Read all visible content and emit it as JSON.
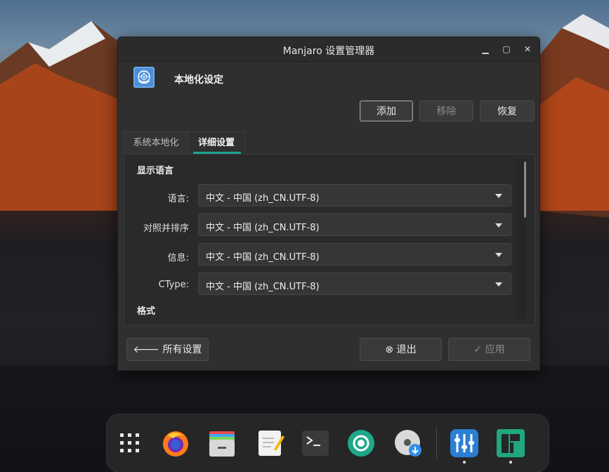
{
  "window": {
    "title": "Manjaro 设置管理器",
    "controls": {
      "minimize": "▁",
      "maximize": "▢",
      "close": "✕"
    }
  },
  "header": {
    "title": "本地化设定"
  },
  "actions": {
    "add": "添加",
    "remove": "移除",
    "restore": "恢复"
  },
  "tabs": [
    {
      "label": "系统本地化",
      "active": false
    },
    {
      "label": "详细设置",
      "active": true
    }
  ],
  "sections": {
    "display_language": "显示语言",
    "formats": "格式"
  },
  "rows": [
    {
      "label": "语言:",
      "value": "中文 - 中国 (zh_CN.UTF-8)"
    },
    {
      "label": "对照并排序",
      "value": "中文 - 中国 (zh_CN.UTF-8)"
    },
    {
      "label": "信息:",
      "value": "中文 - 中国 (zh_CN.UTF-8)"
    },
    {
      "label": "CType:",
      "value": "中文 - 中国 (zh_CN.UTF-8)"
    }
  ],
  "footer": {
    "all_settings": "所有设置",
    "quit": "退出",
    "apply": "应用"
  },
  "dock": {
    "items": [
      {
        "icon": "app-grid-icon"
      },
      {
        "icon": "firefox-icon"
      },
      {
        "icon": "file-manager-icon"
      },
      {
        "icon": "text-editor-icon"
      },
      {
        "icon": "terminal-icon"
      },
      {
        "icon": "camera-shutter-icon"
      },
      {
        "icon": "disc-installer-icon"
      },
      {
        "icon": "settings-manager-icon",
        "running": true
      },
      {
        "icon": "manjaro-logo-icon",
        "running": true
      }
    ]
  },
  "colors": {
    "accent": "#1aa595",
    "window_bg": "#2f2f2f",
    "panel_bg": "#2a2a2a"
  }
}
